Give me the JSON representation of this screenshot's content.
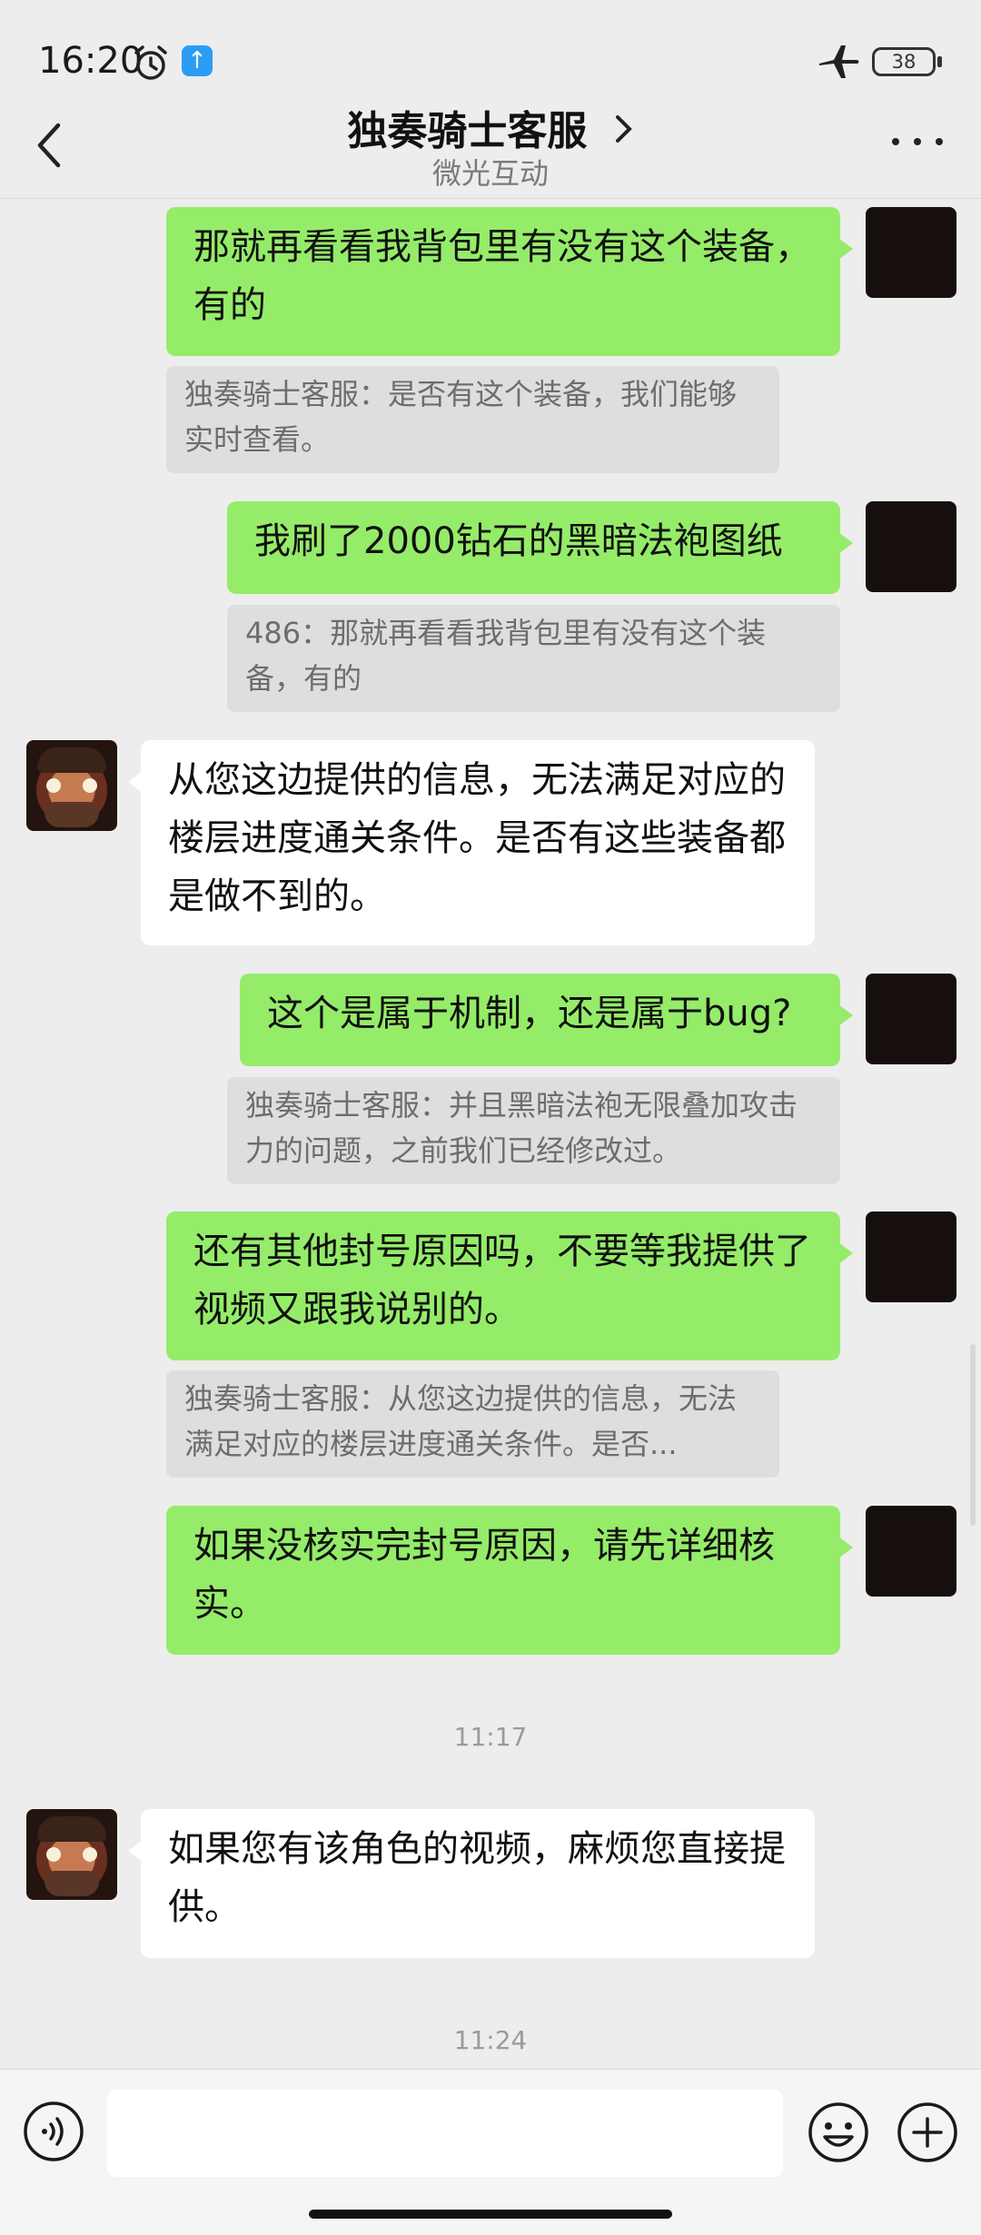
{
  "status_bar": {
    "time": "16:20",
    "battery": "38",
    "upload_glyph": "↑"
  },
  "header": {
    "title": "独奏骑士客服",
    "subtitle": "微光互动"
  },
  "messages": [
    {
      "text": "那就再看看我背包里有没有这个装备，有的",
      "quote": "独奏骑士客服：是否有这个装备，我们能够实时查看。"
    },
    {
      "text": "我刷了2000钻石的黑暗法袍图纸",
      "quote": "486：那就再看看我背包里有没有这个装备，有的"
    },
    {
      "text": "从您这边提供的信息，无法满足对应的楼层进度通关条件。是否有这些装备都是做不到的。"
    },
    {
      "text": "这个是属于机制，还是属于bug?",
      "quote": "独奏骑士客服：并且黑暗法袍无限叠加攻击力的问题，之前我们已经修改过。"
    },
    {
      "text": "还有其他封号原因吗，不要等我提供了视频又跟我说别的。",
      "quote": "独奏骑士客服：从您这边提供的信息，无法满足对应的楼层进度通关条件。是否..."
    },
    {
      "text": "如果没核实完封号原因，请先详细核实。"
    },
    {
      "timestamp": "11:17"
    },
    {
      "text": "如果您有该角色的视频，麻烦您直接提供。"
    },
    {
      "timestamp": "11:24"
    }
  ],
  "input_bar": {
    "placeholder": ""
  },
  "icons": [
    "alarm-icon",
    "upload-icon",
    "airplane-icon",
    "battery-icon",
    "back-arrow-icon",
    "chevron-right-icon",
    "more-dots-icon",
    "voice-icon",
    "emoji-icon",
    "plus-icon"
  ],
  "colors": {
    "my_bubble": "#95ec69",
    "their_bubble": "#ffffff",
    "background": "#ededed",
    "quote_bg": "#dedede"
  }
}
